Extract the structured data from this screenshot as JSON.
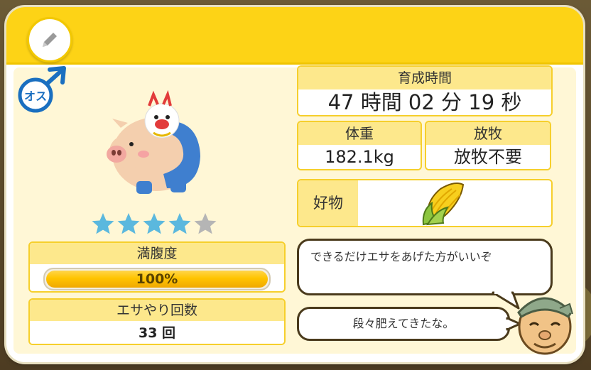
{
  "gender": {
    "label": "オス",
    "icon": "male-icon"
  },
  "rating": {
    "stars_filled": 4,
    "stars_total": 5
  },
  "fullness": {
    "label": "満腹度",
    "value_text": "100%",
    "value": 1.0
  },
  "feed_count": {
    "label": "エサやり回数",
    "value": "33 回"
  },
  "breeding_time": {
    "label": "育成時間",
    "value": "47 時間 02 分 19 秒"
  },
  "weight": {
    "label": "体重",
    "value": "182.1kg"
  },
  "grazing": {
    "label": "放牧",
    "value": "放牧不要"
  },
  "favorite": {
    "label": "好物",
    "icon": "corn-icon"
  },
  "dialog": {
    "line1": "できるだけエサをあげた方がいいぞ",
    "line2": "段々肥えてきたな。"
  },
  "colors": {
    "accent": "#fdd316",
    "star": "#5bb8de",
    "star_empty": "#b5b5b5"
  }
}
